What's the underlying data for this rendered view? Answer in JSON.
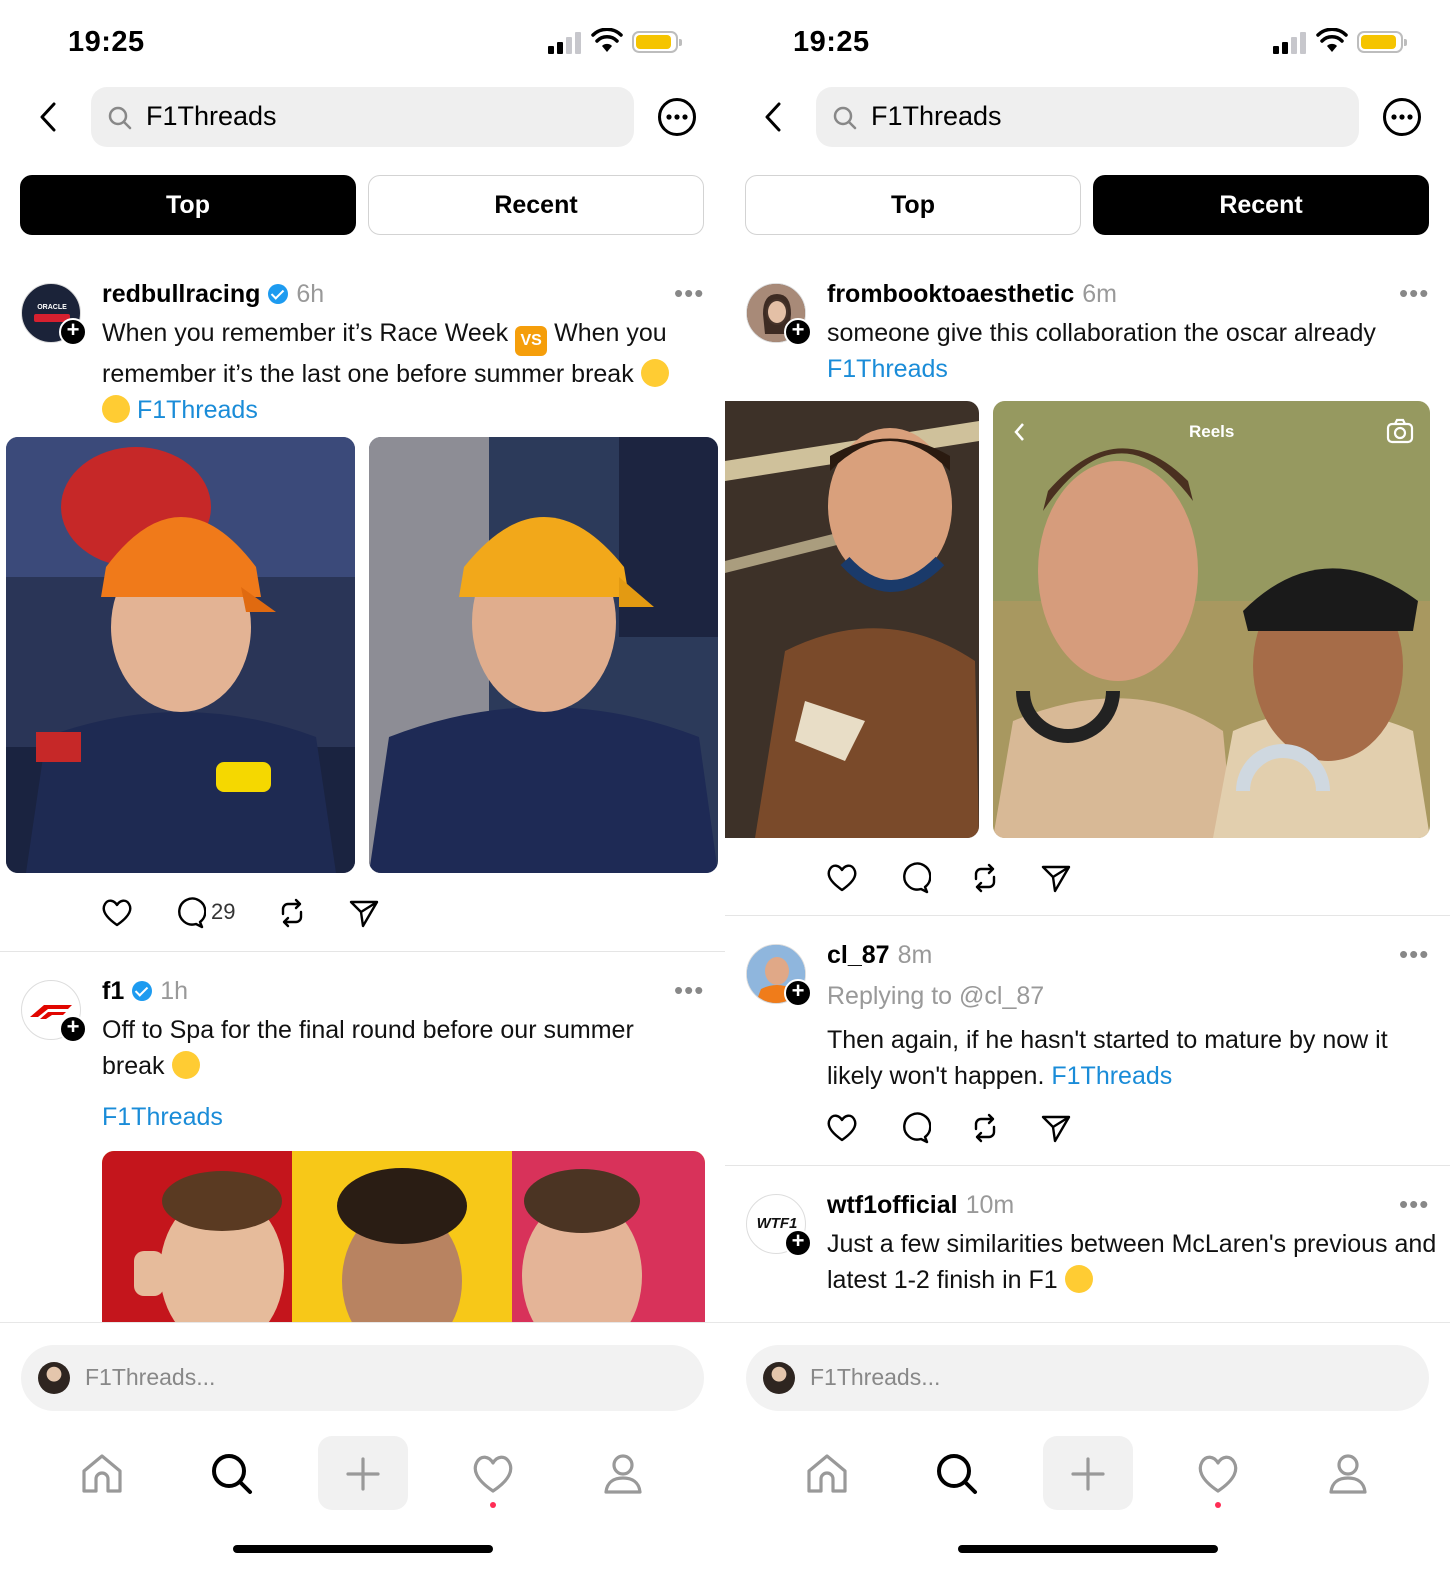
{
  "left": {
    "status": {
      "time": "19:25"
    },
    "search": {
      "query": "F1Threads"
    },
    "segments": {
      "top": "Top",
      "recent": "Recent",
      "active": "top"
    },
    "posts": [
      {
        "username": "redbullracing",
        "verified": true,
        "time": "6h",
        "text1": "When you remember it’s Race Week",
        "text2": "When you remember it’s the last one before summer break",
        "hashtag": "F1Threads",
        "emoji_vs": "VS",
        "comments": "29",
        "avatar_text": "ORACLE"
      },
      {
        "username": "f1",
        "verified": true,
        "time": "1h",
        "text": "Off to Spa for the final round before our summer break",
        "hashtag": "F1Threads"
      }
    ],
    "composer": {
      "placeholder": "F1Threads..."
    }
  },
  "right": {
    "status": {
      "time": "19:25"
    },
    "search": {
      "query": "F1Threads"
    },
    "segments": {
      "top": "Top",
      "recent": "Recent",
      "active": "recent"
    },
    "posts": [
      {
        "username": "frombooktoaesthetic",
        "time": "6m",
        "text": "someone give this collaboration the oscar already",
        "hashtag": "F1Threads",
        "reels_label": "Reels"
      },
      {
        "username": "cl_87",
        "time": "8m",
        "replying": "Replying to @cl_87",
        "text": "Then again, if he hasn't started to mature by now it likely won't happen.",
        "hashtag": "F1Threads"
      },
      {
        "username": "wtf1official",
        "time": "10m",
        "text": "Just a few similarities between McLaren's previous and latest 1-2 finish in F1",
        "avatar_text": "WTF1"
      }
    ],
    "composer": {
      "placeholder": "F1Threads..."
    }
  },
  "colors": {
    "accent_link": "#1a8cd8",
    "verified": "#1d9bf0",
    "battery": "#f5c400",
    "notification_dot": "#ff2d55"
  },
  "icons": [
    "signal-icon",
    "wifi-icon",
    "battery-icon",
    "back-chevron-icon",
    "search-icon",
    "more-circle-icon",
    "more-dots-icon",
    "heart-icon",
    "comment-icon",
    "repost-icon",
    "share-icon",
    "home-icon",
    "plus-icon",
    "profile-icon",
    "camera-icon"
  ]
}
